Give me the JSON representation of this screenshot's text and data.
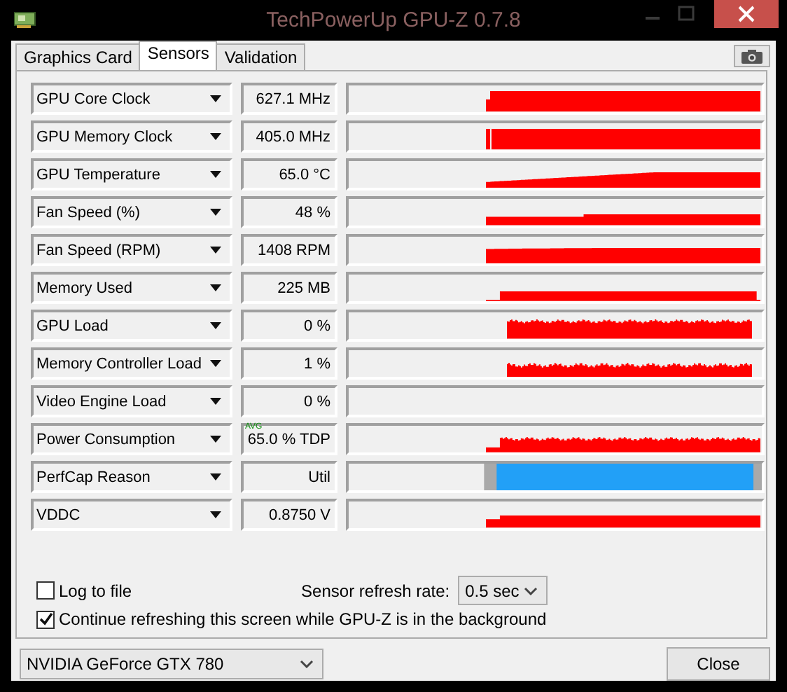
{
  "window": {
    "title": "TechPowerUp GPU-Z 0.7.8"
  },
  "tabs": [
    {
      "label": "Graphics Card",
      "selected": false
    },
    {
      "label": "Sensors",
      "selected": true
    },
    {
      "label": "Validation",
      "selected": false
    }
  ],
  "sensors": [
    {
      "name": "GPU Core Clock",
      "value": "627.1 MHz",
      "kind": "graph"
    },
    {
      "name": "GPU Memory Clock",
      "value": "405.0 MHz",
      "kind": "graph"
    },
    {
      "name": "GPU Temperature",
      "value": "65.0 °C",
      "kind": "graph"
    },
    {
      "name": "Fan Speed (%)",
      "value": "48 %",
      "kind": "graph"
    },
    {
      "name": "Fan Speed (RPM)",
      "value": "1408 RPM",
      "kind": "graph"
    },
    {
      "name": "Memory Used",
      "value": "225 MB",
      "kind": "graph"
    },
    {
      "name": "GPU Load",
      "value": "0 %",
      "kind": "graph"
    },
    {
      "name": "Memory Controller Load",
      "value": "1 %",
      "kind": "graph"
    },
    {
      "name": "Video Engine Load",
      "value": "0 %",
      "kind": "blank"
    },
    {
      "name": "Power Consumption",
      "value": "65.0 % TDP",
      "badge": "AVG",
      "kind": "graph"
    },
    {
      "name": "PerfCap Reason",
      "value": "Util",
      "kind": "perfcap"
    },
    {
      "name": "VDDC",
      "value": "0.8750 V",
      "kind": "graph"
    }
  ],
  "options": [
    {
      "label": "Log to file",
      "checked": false
    },
    {
      "label": "Continue refreshing this screen while GPU-Z is in the background",
      "checked": true
    }
  ],
  "refresh": {
    "label": "Sensor refresh rate:",
    "value": "0.5 sec"
  },
  "gpu_select": {
    "value": "NVIDIA GeForce GTX 780"
  },
  "buttons": [
    {
      "label": "Close"
    }
  ]
}
